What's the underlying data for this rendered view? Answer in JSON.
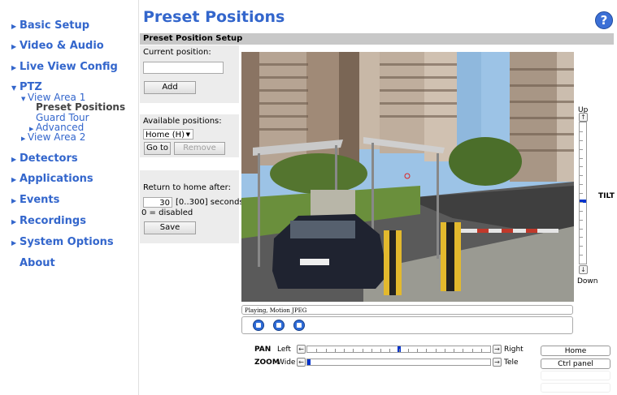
{
  "sidebar": {
    "items": [
      {
        "label": "Basic Setup"
      },
      {
        "label": "Video & Audio"
      },
      {
        "label": "Live View Config"
      },
      {
        "label": "PTZ"
      },
      {
        "label": "Detectors"
      },
      {
        "label": "Applications"
      },
      {
        "label": "Events"
      },
      {
        "label": "Recordings"
      },
      {
        "label": "System Options"
      },
      {
        "label": "About"
      }
    ],
    "ptz_sub": {
      "view_area_1": "View Area 1",
      "preset_positions": "Preset Positions",
      "guard_tour": "Guard Tour",
      "advanced": "Advanced",
      "view_area_2": "View Area 2"
    }
  },
  "header": {
    "title": "Preset Positions",
    "help": "?"
  },
  "setup": {
    "section_title": "Preset Position Setup",
    "current_position_label": "Current position:",
    "current_position_value": "",
    "add_label": "Add",
    "available_positions_label": "Available positions:",
    "selected_position": "Home (H)",
    "goto_label": "Go to",
    "remove_label": "Remove",
    "return_home_label": "Return to home after:",
    "return_home_value": "30",
    "return_home_range": "[0..300] seconds,",
    "return_home_note": "0 = disabled",
    "save_label": "Save"
  },
  "video": {
    "status": "Playing, Motion JPEG"
  },
  "tilt": {
    "up_label": "Up",
    "down_label": "Down",
    "name": "TILT",
    "level": 0.56
  },
  "pan": {
    "name": "PAN",
    "left": "Left",
    "right": "Right",
    "level": 0.5
  },
  "zoom": {
    "name": "ZOOM",
    "wide": "Wide",
    "tele": "Tele",
    "level": 0.0
  },
  "buttons": {
    "home": "Home",
    "ctrl_panel": "Ctrl panel"
  },
  "colors": {
    "accent": "#3366cc",
    "slider_handle": "#0033cc"
  }
}
